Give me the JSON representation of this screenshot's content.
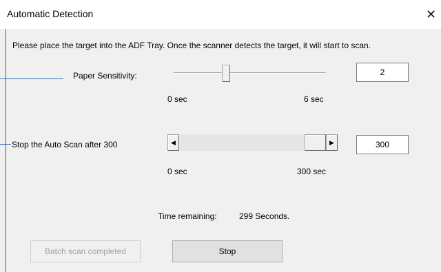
{
  "window": {
    "title": "Automatic Detection",
    "close_glyph": "✕"
  },
  "instruction": "Please place the target into the ADF Tray. Once the scanner detects the target, it will start to scan.",
  "paper_sensitivity": {
    "label": "Paper Sensitivity:",
    "value": "2",
    "min_label": "0 sec",
    "max_label": "6 sec",
    "level": 2,
    "min": 0,
    "max": 6
  },
  "auto_scan": {
    "label": "Stop the Auto Scan after 300",
    "value": "300",
    "min_label": "0 sec",
    "max_label": "300 sec",
    "left_arrow": "◀",
    "right_arrow": "▶",
    "level": 300,
    "min": 0,
    "max": 300
  },
  "status": {
    "label": "Time remaining:",
    "value": "299 Seconds."
  },
  "buttons": {
    "batch_done": "Batch scan completed",
    "stop": "Stop"
  },
  "colors": {
    "leader_line": "#2f6fad",
    "dialog_bg": "#f0f0f0"
  }
}
